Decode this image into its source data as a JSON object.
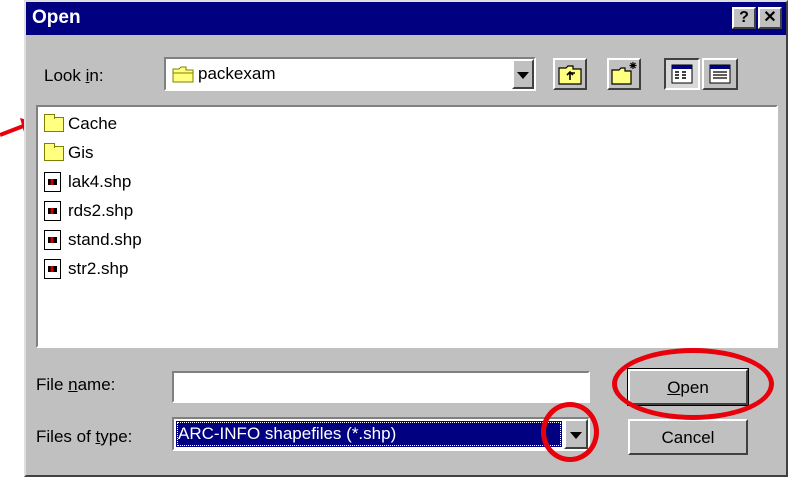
{
  "dialog": {
    "title": "Open",
    "help_button": "?",
    "close_button": "✕"
  },
  "look_in": {
    "label_pre": "Look ",
    "label_key": "i",
    "label_post": "n:",
    "value": "packexam"
  },
  "files": [
    {
      "name": "Cache",
      "type": "folder"
    },
    {
      "name": "Gis",
      "type": "folder"
    },
    {
      "name": "lak4.shp",
      "type": "file"
    },
    {
      "name": "rds2.shp",
      "type": "file"
    },
    {
      "name": "stand.shp",
      "type": "file"
    },
    {
      "name": "str2.shp",
      "type": "file"
    }
  ],
  "file_name": {
    "label_pre": "File ",
    "label_key": "n",
    "label_post": "ame:",
    "value": ""
  },
  "file_type": {
    "label_pre": "Files of ",
    "label_key": "t",
    "label_post": "ype:",
    "value": "ARC-INFO shapefiles (*.shp)"
  },
  "buttons": {
    "open_key": "O",
    "open_rest": "pen",
    "cancel": "Cancel"
  },
  "colors": {
    "titlebar": "#000080",
    "face": "#c0c0c0",
    "selection": "#000080",
    "annotation": "#e8000b"
  },
  "icons": [
    "up-folder-icon",
    "new-folder-icon",
    "list-view-icon",
    "details-view-icon",
    "folder-icon",
    "shapefile-icon"
  ]
}
